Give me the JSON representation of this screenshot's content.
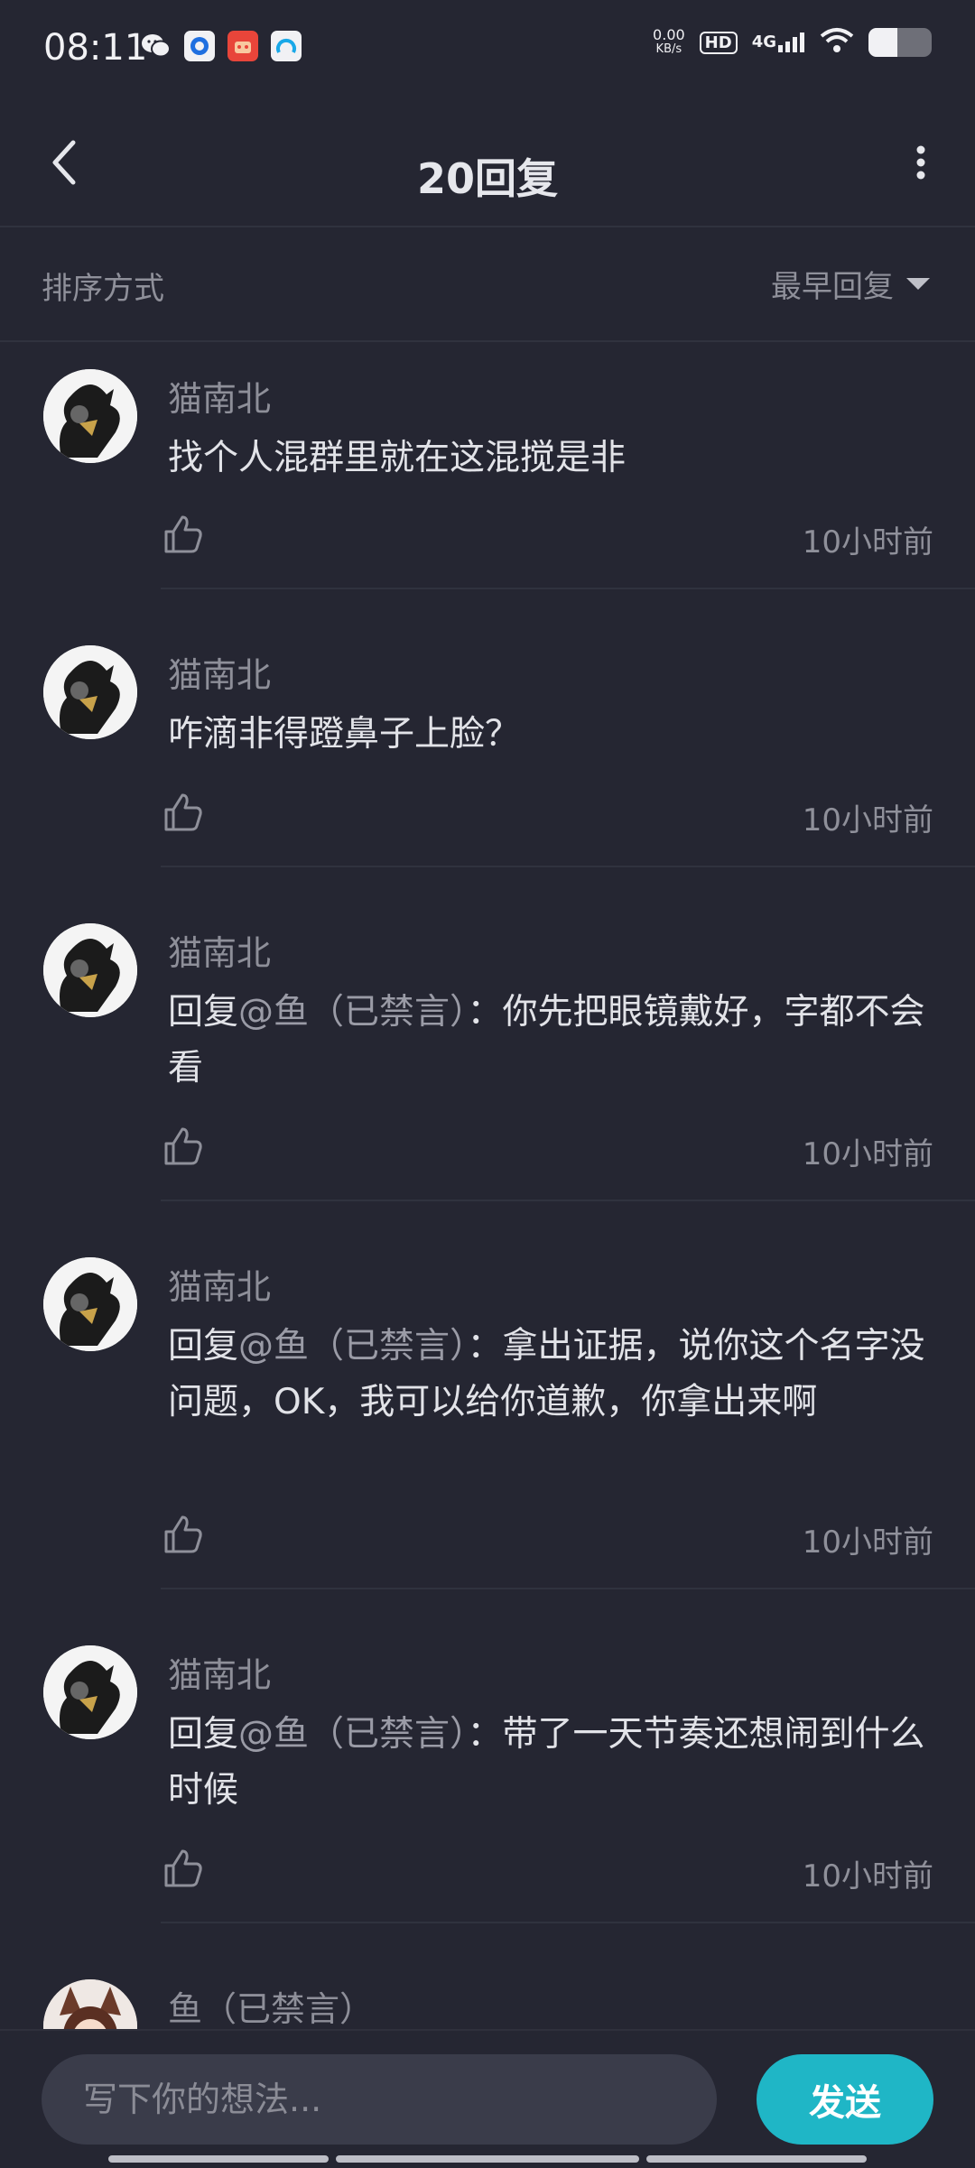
{
  "status_bar": {
    "time": "08:11",
    "net_speed_value": "0.00",
    "net_speed_unit": "KB/s",
    "hd": "HD",
    "network": "4G",
    "battery_level": 0.45,
    "app_icons": [
      "wechat-icon",
      "app-blue-icon",
      "app-red-icon",
      "app-cyan-icon"
    ]
  },
  "header": {
    "title": "20回复"
  },
  "sort": {
    "label": "排序方式",
    "value": "最早回复"
  },
  "comments": [
    {
      "user": "猫南北",
      "text": "找个人混群里就在这混搅是非",
      "time": "10小时前"
    },
    {
      "user": "猫南北",
      "text": "咋滴非得蹬鼻子上脸？",
      "time": "10小时前"
    },
    {
      "user": "猫南北",
      "prefix": "回复",
      "mention": "@鱼（已禁言）",
      "text": "：你先把眼镜戴好，字都不会看",
      "time": "10小时前"
    },
    {
      "user": "猫南北",
      "prefix": "回复",
      "mention": "@鱼（已禁言）",
      "text": "：拿出证据，说你这个名字没问题，OK，我可以给你道歉，你拿出来啊",
      "time": "10小时前"
    },
    {
      "user": "猫南北",
      "prefix": "回复",
      "mention": "@鱼（已禁言）",
      "text": "：带了一天节奏还想闹到什么时候",
      "time": "10小时前"
    },
    {
      "user": "鱼（已禁言）"
    }
  ],
  "composer": {
    "placeholder": "写下你的想法...",
    "send_label": "发送"
  },
  "colors": {
    "background": "#252632",
    "accent": "#1fb6c6",
    "muted_text": "#8f909a"
  }
}
